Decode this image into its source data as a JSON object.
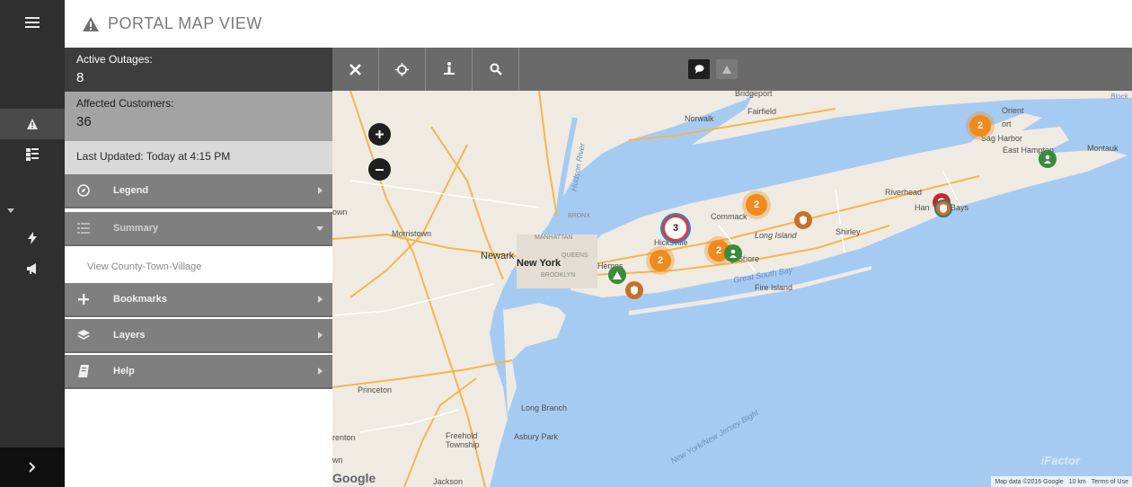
{
  "header": {
    "title": "PORTAL MAP VIEW"
  },
  "stats": {
    "active_outages_label": "Active Outages:",
    "active_outages_value": "8",
    "affected_customers_label": "Affected Customers:",
    "affected_customers_value": "36",
    "last_updated": "Last Updated: Today at 4:15 PM"
  },
  "panel": {
    "sections": [
      {
        "label": "Legend",
        "icon": "compass-icon",
        "state": "collapsed"
      },
      {
        "label": "Summary",
        "icon": "list-icon",
        "state": "expanded"
      },
      {
        "label": "Bookmarks",
        "icon": "plus-icon",
        "state": "collapsed"
      },
      {
        "label": "Layers",
        "icon": "layers-icon",
        "state": "collapsed"
      },
      {
        "label": "Help",
        "icon": "book-icon",
        "state": "collapsed"
      }
    ],
    "summary_item": "View County-Town-Village"
  },
  "rail": {
    "items": [
      "menu-icon",
      "warning-icon",
      "report-icon",
      "lightning-icon",
      "megaphone-icon",
      "chevron-right-icon"
    ]
  },
  "toolbar": {
    "tools": [
      "close-icon",
      "locate-icon",
      "info-person-icon",
      "search-icon"
    ],
    "toggles": [
      "comment-icon",
      "warning-icon"
    ]
  },
  "map": {
    "labels": {
      "bridgeport": "Bridgeport",
      "fairfield": "Fairfield",
      "norwalk": "Norwalk",
      "orient": "Orient",
      "ort": "ort",
      "montauk": "Montauk",
      "sag_harbor": "Sag Harbor",
      "east_hampton": "East Hampton",
      "riverhead": "Riverhead",
      "hampton_bays_left": "Han",
      "hampton_bays_right": "Bays",
      "commack": "Commack",
      "long_island": "Long Island",
      "shirley": "Shirley",
      "hicksville": "Hicksville",
      "bay_shore": "y Shore",
      "great_south_bay": "Great South Bay",
      "fire_island": "Fire Island",
      "hempstead": "Hemps",
      "newark": "Newark",
      "new_york": "New York",
      "queens": "QUEENS",
      "brooklyn": "BROOKLYN",
      "manhattan": "MANHATTAN",
      "bronx": "BRONX",
      "hudson_river": "Hudson River",
      "morristown": "Morristown",
      "own": "own",
      "princeton": "Princeton",
      "long_branch": "Long Branch",
      "asbury_park": "Asbury Park",
      "freehold_1": "Freehold",
      "freehold_2": "Township",
      "trenton": "renton",
      "wn": "wn",
      "jackson": "Jackson",
      "bight": "New York/New Jersey Bight",
      "block": "Block"
    },
    "clusters": [
      {
        "name": "cluster-orient",
        "count": "2"
      },
      {
        "name": "cluster-commack",
        "count": "2"
      },
      {
        "name": "cluster-hicksville",
        "count": "3"
      },
      {
        "name": "cluster-bayshore",
        "count": "2"
      },
      {
        "name": "cluster-hempstead",
        "count": "2"
      }
    ],
    "google": "Google",
    "watermark": "iFactor",
    "attribution": {
      "data": "Map data ©2016 Google",
      "scale": "10 km",
      "terms": "Terms of Use"
    },
    "colors": {
      "water": "#a6cbf2",
      "land": "#efebe2",
      "cluster": "#f08a1d",
      "pin_green": "#3c8a3c",
      "pin_orange": "#c8702a",
      "pin_red": "#c62828"
    }
  }
}
